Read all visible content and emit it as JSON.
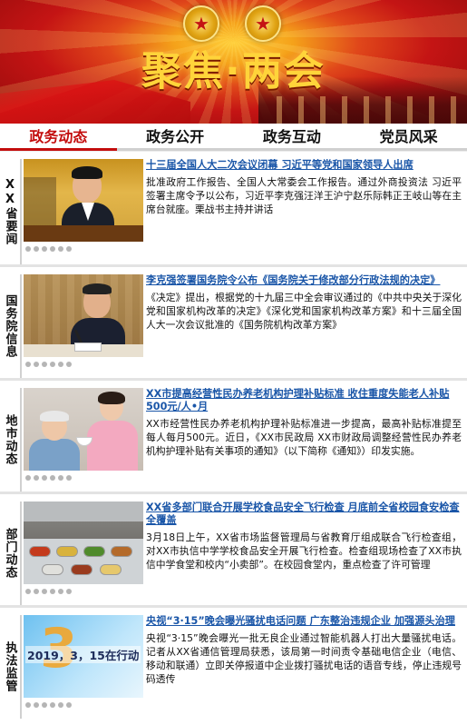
{
  "banner": {
    "title": "聚焦·两会"
  },
  "tabs": [
    {
      "label": "政务动态",
      "active": true
    },
    {
      "label": "政务公开",
      "active": false
    },
    {
      "label": "政务互动",
      "active": false
    },
    {
      "label": "党员风采",
      "active": false
    }
  ],
  "sections": [
    {
      "label": "XX省要闻",
      "headline": "十三届全国人大二次会议闭幕 习近平等党和国家领导人出席",
      "summary": "批准政府工作报告、全国人大常委会工作报告。通过外商投资法 习近平签署主席令予以公布，习近平李克强汪洋王沪宁赵乐际韩正王岐山等在主席台就座。栗战书主持并讲话"
    },
    {
      "label": "国务院信息",
      "headline": "李克强签署国务院令公布《国务院关于修改部分行政法规的决定》",
      "summary": "《决定》提出，根据党的十九届三中全会审议通过的《中共中央关于深化党和国家机构改革的决定》《深化党和国家机构改革方案》和十三届全国人大一次会议批准的《国务院机构改革方案》"
    },
    {
      "label": "地市动态",
      "headline": "XX市提高经营性民办养老机构护理补贴标准 收住重度失能老人补贴500元/人•月",
      "summary": "XX市经营性民办养老机构护理补贴标准进一步提高，最高补贴标准提至每人每月500元。近日，《XX市民政局 XX市财政局调整经营性民办养老机构护理补贴有关事项的通知》（以下简称《通知》）印发实施。"
    },
    {
      "label": "部门动态",
      "headline": "XX省多部门联合开展学校食品安全飞行检查 月底前全省校园食安检查全覆盖",
      "summary": "3月18日上午，XX省市场监督管理局与省教育厅组成联合飞行检查组，对XX市执信中学学校食品安全开展飞行检查。检查组现场检查了XX市执信中学食堂和校内“小卖部”。在校园食堂内，重点检查了许可管理"
    },
    {
      "label": "执法监管",
      "headline": "央视“3·15”晚会曝光骚扰电话问题 广东整治违规企业 加强源头治理",
      "summary": "央视“3·15”晚会曝光一批无良企业通过智能机器人打出大量骚扰电话。记者从XX省通信管理局获悉，该局第一时间责令基础电信企业（电信、移动和联通）立即关停报道中企业拨打骚扰电话的语音专线，停止违规号码透传",
      "image_text": "2019，3，15在行动"
    }
  ]
}
